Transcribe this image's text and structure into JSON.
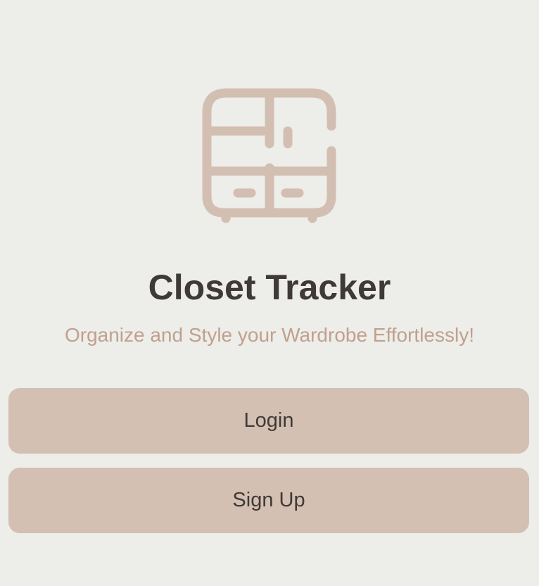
{
  "app": {
    "logo_icon": "wardrobe-icon",
    "title": "Closet Tracker",
    "subtitle": "Organize and Style your Wardrobe Effortlessly!"
  },
  "actions": {
    "login_label": "Login",
    "signup_label": "Sign Up"
  },
  "colors": {
    "background": "#EDEDE9",
    "accent": "#D3C0B3",
    "subtitle": "#C0A08E",
    "text": "#3F3A37"
  }
}
